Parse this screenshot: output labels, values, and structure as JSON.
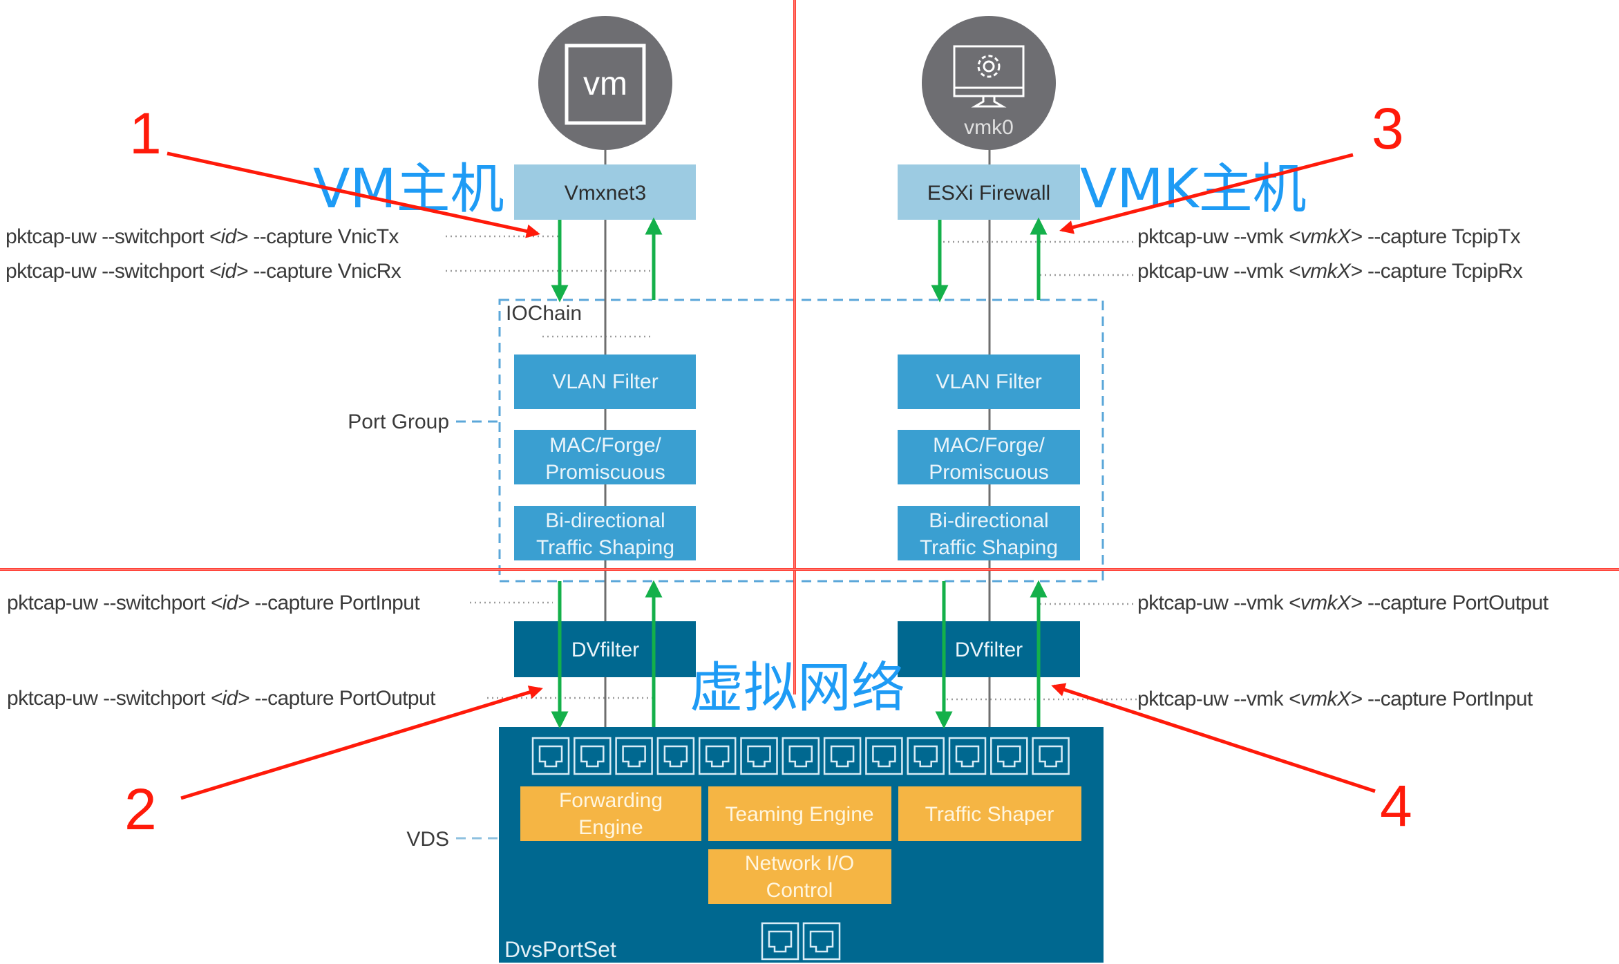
{
  "diagram": {
    "left_host": {
      "title": "VM主机",
      "icon_label": "vm",
      "nic": "Vmxnet3",
      "capture_tx": {
        "prefix": "pktcap-uw --switchport ",
        "arg": "<id>",
        "suffix": " --capture VnicTx"
      },
      "capture_rx": {
        "prefix": "pktcap-uw --switchport ",
        "arg": "<id>",
        "suffix": " --capture VnicRx"
      },
      "port_input": {
        "prefix": "pktcap-uw --switchport ",
        "arg": "<id>",
        "suffix": " --capture PortInput"
      },
      "port_output": {
        "prefix": "pktcap-uw --switchport ",
        "arg": "<id>",
        "suffix": " --capture PortOutput"
      },
      "iochain": [
        "VLAN Filter",
        [
          "MAC/Forge/",
          "Promiscuous"
        ],
        [
          "Bi-directional",
          "Traffic Shaping"
        ]
      ],
      "dvfilter": "DVfilter"
    },
    "right_host": {
      "title": "VMK主机",
      "icon_label": "vmk0",
      "nic": "ESXi Firewall",
      "capture_tx": {
        "prefix": "pktcap-uw --vmk ",
        "arg": "<vmkX>",
        "suffix": " --capture TcpipTx"
      },
      "capture_rx": {
        "prefix": "pktcap-uw --vmk ",
        "arg": "<vmkX>",
        "suffix": " --capture TcpipRx"
      },
      "port_output": {
        "prefix": "pktcap-uw --vmk ",
        "arg": "<vmkX>",
        "suffix": " --capture PortOutput"
      },
      "port_input": {
        "prefix": "pktcap-uw --vmk ",
        "arg": "<vmkX>",
        "suffix": " --capture PortInput"
      },
      "iochain": [
        "VLAN Filter",
        [
          "MAC/Forge/",
          "Promiscuous"
        ],
        [
          "Bi-directional",
          "Traffic Shaping"
        ]
      ],
      "dvfilter": "DVfilter"
    },
    "iochain_label": "IOChain",
    "port_group_label": "Port Group",
    "vds_label": "VDS",
    "virtual_network_label": "虚拟网络",
    "dvsportset": {
      "label": "DvsPortSet",
      "port_count_top": 13,
      "port_count_bottom": 2,
      "engines": {
        "forwarding": [
          "Forwarding",
          "Engine"
        ],
        "teaming": "Teaming Engine",
        "traffic_shaper": "Traffic Shaper",
        "nioc": [
          "Network I/O",
          "Control"
        ]
      }
    },
    "annotations": [
      "1",
      "2",
      "3",
      "4"
    ],
    "colors": {
      "host_circle": "#6e6e72",
      "nic_box": "#9ccbe2",
      "iochain_box": "#3a9fd1",
      "dvfilter_box": "#006890",
      "dvs_box": "#006890",
      "engine_box": "#f5b544",
      "flow_arrow": "#14b04a",
      "annotation_red": "#ff1a0a",
      "title_blue": "#1e9bf5",
      "dashed_blue": "#5ba7d9"
    }
  }
}
